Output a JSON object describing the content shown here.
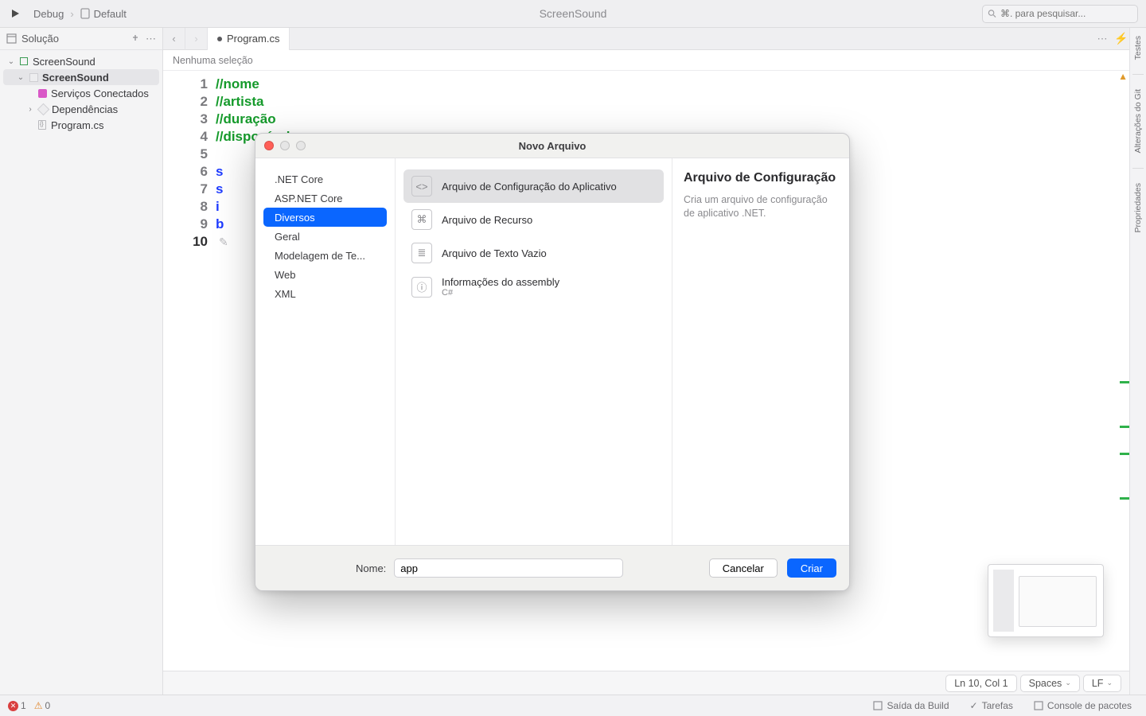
{
  "toolbar": {
    "config": "Debug",
    "target": "Default",
    "title": "ScreenSound",
    "search_placeholder": "⌘. para pesquisar..."
  },
  "sidebar": {
    "header": "Solução",
    "tree": {
      "solution": "ScreenSound",
      "project": "ScreenSound",
      "items": [
        "Serviços Conectados",
        "Dependências",
        "Program.cs"
      ]
    }
  },
  "tabs": {
    "active": "Program.cs"
  },
  "breadcrumb": "Nenhuma seleção",
  "code": {
    "lines": [
      {
        "n": 1,
        "kind": "comment",
        "text": "//nome"
      },
      {
        "n": 2,
        "kind": "comment",
        "text": "//artista"
      },
      {
        "n": 3,
        "kind": "comment",
        "text": "//duração"
      },
      {
        "n": 4,
        "kind": "comment",
        "text": "//disponível"
      },
      {
        "n": 5,
        "kind": "blank",
        "text": ""
      },
      {
        "n": 6,
        "kind": "kw",
        "text": "s"
      },
      {
        "n": 7,
        "kind": "kw",
        "text": "s"
      },
      {
        "n": 8,
        "kind": "kw",
        "text": "i"
      },
      {
        "n": 9,
        "kind": "kw",
        "text": "b"
      },
      {
        "n": 10,
        "kind": "blank",
        "text": ""
      }
    ],
    "current_line": 10
  },
  "right_rail": [
    "Testes",
    "Alterações do Git",
    "Propriedades"
  ],
  "editor_status": {
    "position": "Ln 10, Col 1",
    "indent": "Spaces",
    "eol": "LF"
  },
  "footer": {
    "errors": "1",
    "warnings": "0",
    "panels": [
      "Saída da Build",
      "Tarefas",
      "Console de pacotes"
    ]
  },
  "dialog": {
    "title": "Novo Arquivo",
    "categories": [
      ".NET Core",
      "ASP.NET Core",
      "Diversos",
      "Geral",
      "Modelagem de Te...",
      "Web",
      "XML"
    ],
    "selected_category_index": 2,
    "templates": [
      {
        "label": "Arquivo de Configuração do Aplicativo",
        "sub": "",
        "icon": "<>"
      },
      {
        "label": "Arquivo de Recurso",
        "sub": "",
        "icon": "⌘"
      },
      {
        "label": "Arquivo de Texto Vazio",
        "sub": "",
        "icon": "≣"
      },
      {
        "label": "Informações do assembly",
        "sub": "C#",
        "icon": "ⓘ"
      }
    ],
    "selected_template_index": 0,
    "detail": {
      "heading": "Arquivo de Configuração",
      "desc": "Cria um arquivo de configuração de aplicativo .NET."
    },
    "name_label": "Nome:",
    "name_value": "app",
    "cancel": "Cancelar",
    "create": "Criar"
  }
}
